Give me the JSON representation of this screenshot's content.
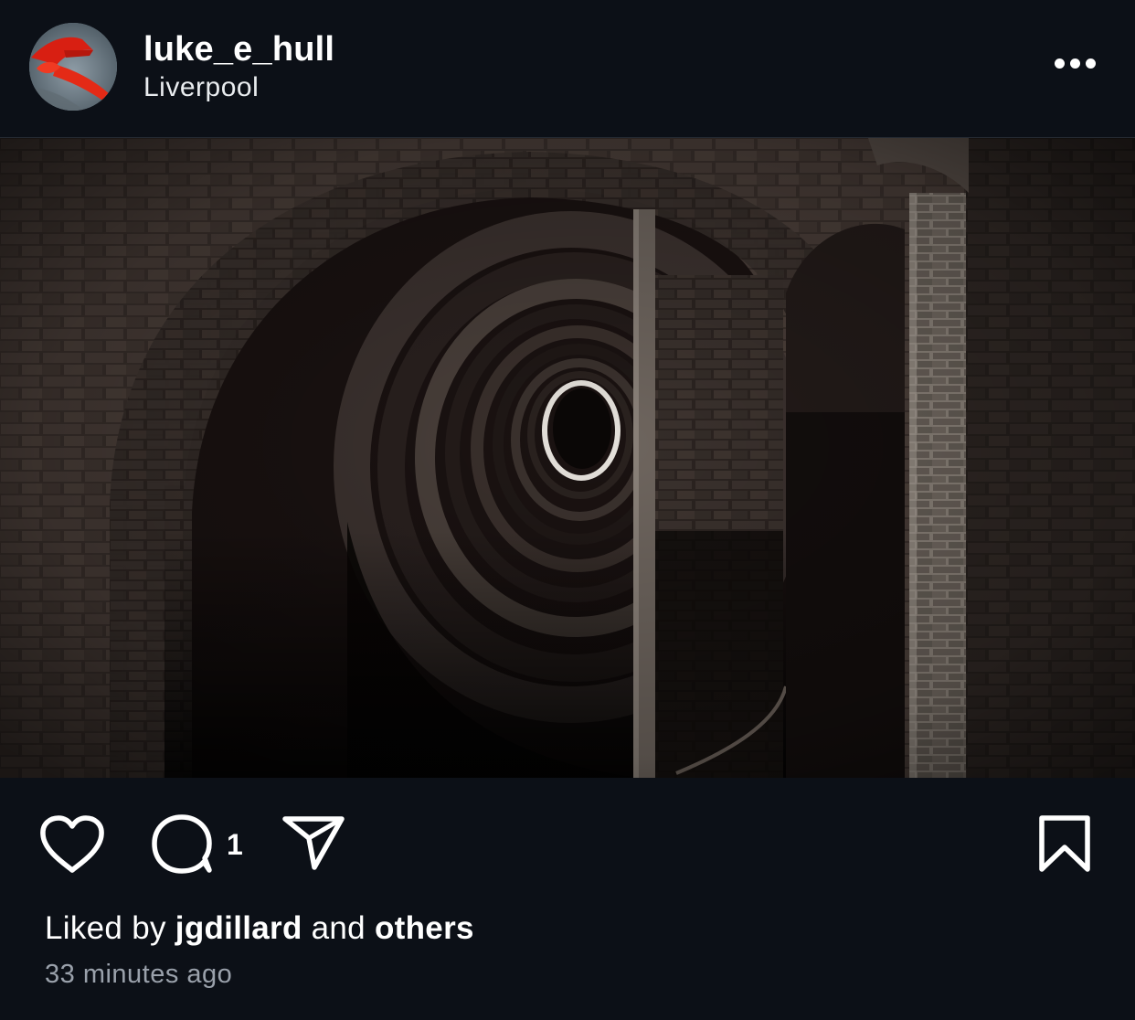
{
  "header": {
    "username": "luke_e_hull",
    "location": "Liverpool",
    "more_icon": "more-horizontal-icon"
  },
  "media": {
    "kind": "photo"
  },
  "actions": {
    "like_icon": "heart-icon",
    "comment_icon": "comment-bubble-icon",
    "comment_count": "1",
    "share_icon": "paper-plane-icon",
    "save_icon": "bookmark-icon"
  },
  "likes": {
    "prefix": "Liked by",
    "first_user": "jgdillard",
    "connector": "and",
    "others": "others"
  },
  "timestamp": "33 minutes ago",
  "colors": {
    "background": "#0c1017",
    "text_primary": "#ffffff",
    "text_secondary": "#9aa1ab"
  }
}
